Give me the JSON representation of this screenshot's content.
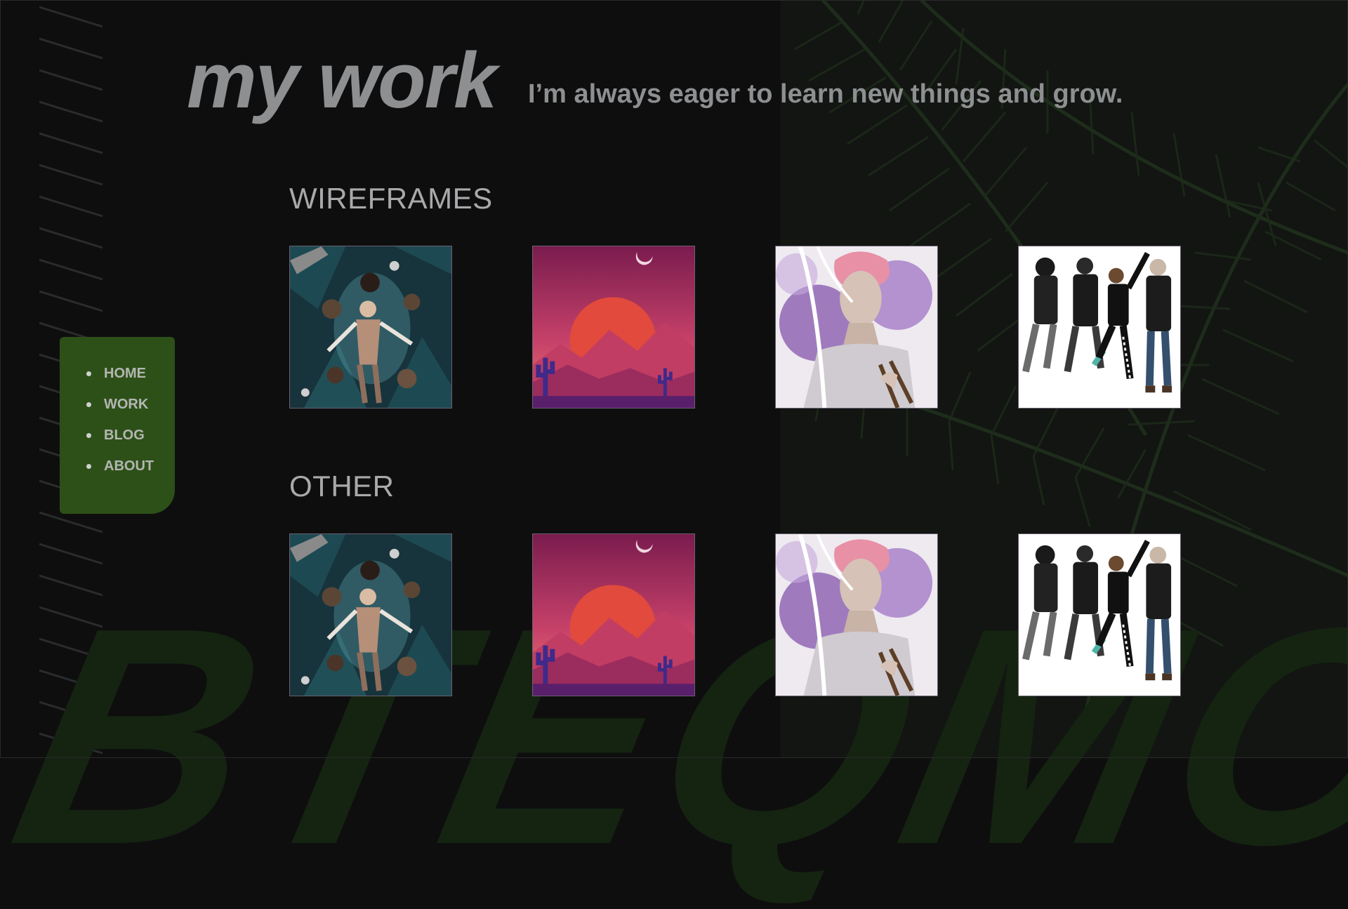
{
  "header": {
    "title": "my work",
    "tagline": "I’m always eager to learn new things and grow."
  },
  "nav": {
    "items": [
      {
        "label": "HOME"
      },
      {
        "label": "WORK"
      },
      {
        "label": "BLOG"
      },
      {
        "label": "ABOUT"
      }
    ]
  },
  "sections": [
    {
      "title": "WIREFRAMES"
    },
    {
      "title": "OTHER"
    }
  ],
  "artwork": [
    {
      "name": "underwater-figure-illustration"
    },
    {
      "name": "desert-sunset-illustration"
    },
    {
      "name": "pink-haired-portrait-illustration"
    },
    {
      "name": "dancing-group-illustration"
    }
  ],
  "colors": {
    "background": "#0e0e0f",
    "nav_background": "#2d5018",
    "text": "#8d8f91"
  }
}
